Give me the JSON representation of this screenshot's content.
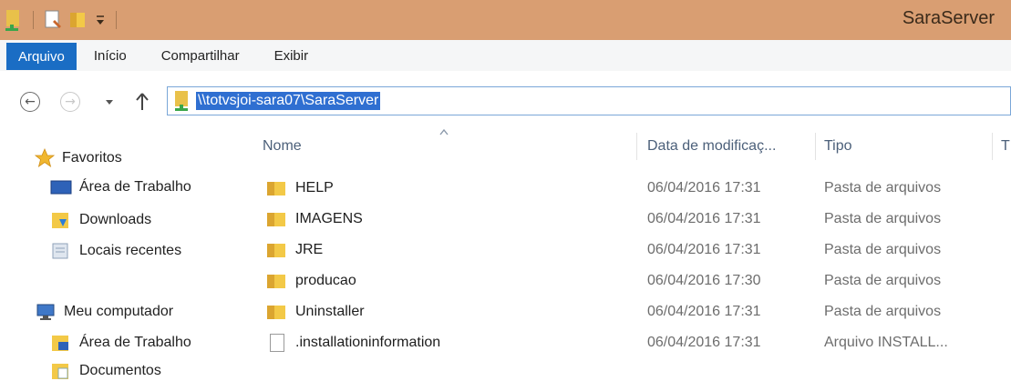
{
  "window": {
    "title": "SaraServer"
  },
  "ribbon": {
    "tabs": [
      "Arquivo",
      "Início",
      "Compartilhar",
      "Exibir"
    ]
  },
  "address": {
    "path": "\\\\totvsjoi-sara07\\SaraServer"
  },
  "nav": {
    "favorites_label": "Favoritos",
    "favorites": [
      "Área de Trabalho",
      "Downloads",
      "Locais recentes"
    ],
    "computer_label": "Meu computador",
    "computer": [
      "Área de Trabalho",
      "Documentos"
    ]
  },
  "list": {
    "headers": {
      "name": "Nome",
      "date": "Data de modificaç...",
      "type": "Tipo",
      "size": "T"
    },
    "rows": [
      {
        "name": "HELP",
        "date": "06/04/2016 17:31",
        "type": "Pasta de arquivos",
        "icon": "folder-icon"
      },
      {
        "name": "IMAGENS",
        "date": "06/04/2016 17:31",
        "type": "Pasta de arquivos",
        "icon": "folder-icon"
      },
      {
        "name": "JRE",
        "date": "06/04/2016 17:31",
        "type": "Pasta de arquivos",
        "icon": "folder-icon"
      },
      {
        "name": "producao",
        "date": "06/04/2016 17:30",
        "type": "Pasta de arquivos",
        "icon": "folder-icon"
      },
      {
        "name": "Uninstaller",
        "date": "06/04/2016 17:31",
        "type": "Pasta de arquivos",
        "icon": "folder-icon"
      },
      {
        "name": ".installationinformation",
        "date": "06/04/2016 17:31",
        "type": "Arquivo INSTALL...",
        "icon": "file-icon"
      }
    ]
  },
  "colors": {
    "titlebar": "#d99e72",
    "accent": "#1a6dc4",
    "selection": "#2f6fd1"
  }
}
